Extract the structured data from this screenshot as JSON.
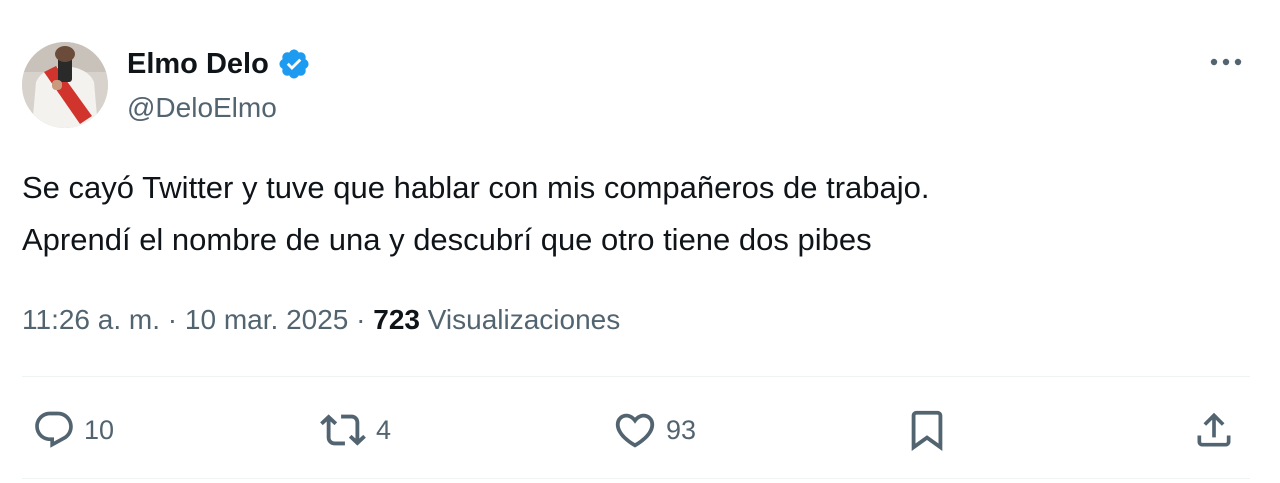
{
  "author": {
    "display_name": "Elmo Delo",
    "handle": "@DeloElmo",
    "verified_color": "#1d9bf0"
  },
  "tweet": {
    "text_lines": [
      "Se cayó Twitter y tuve que hablar con mis compañeros de trabajo.",
      "Aprendí el nombre de una y descubrí que otro tiene dos pibes"
    ]
  },
  "meta": {
    "time": "11:26 a. m.",
    "separator": "·",
    "date": "10 mar. 2025",
    "views_count": "723",
    "views_label": "Visualizaciones"
  },
  "actions": {
    "replies": "10",
    "retweets": "4",
    "likes": "93"
  },
  "icons": [
    "more-icon",
    "verified-badge-icon",
    "reply-icon",
    "retweet-icon",
    "like-icon",
    "bookmark-icon",
    "share-icon"
  ],
  "colors": {
    "text": "#0f1419",
    "secondary": "#536471",
    "accent": "#1d9bf0",
    "divider": "#eff3f4"
  }
}
